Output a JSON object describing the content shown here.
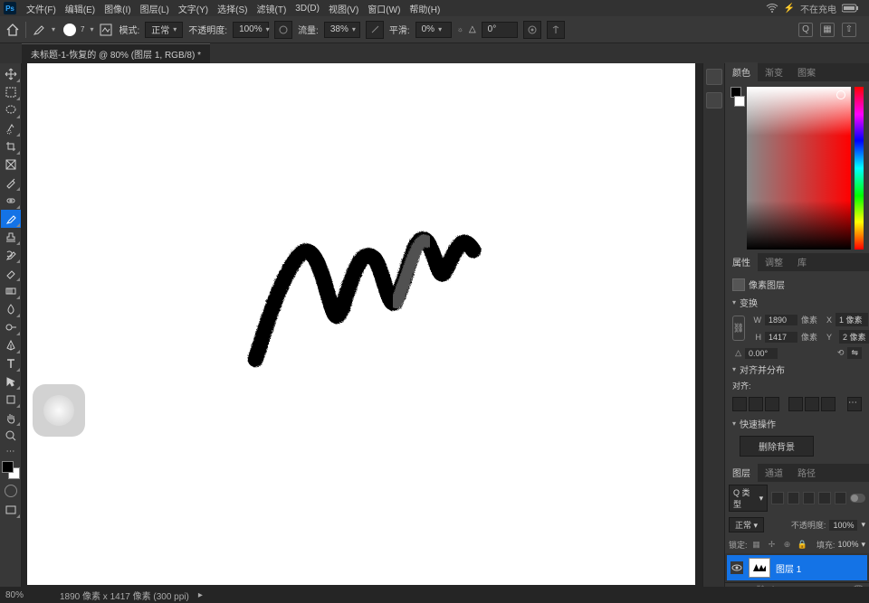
{
  "menubar": {
    "items": [
      "文件(F)",
      "编辑(E)",
      "图像(I)",
      "图层(L)",
      "文字(Y)",
      "选择(S)",
      "滤镜(T)",
      "3D(D)",
      "视图(V)",
      "窗口(W)",
      "帮助(H)"
    ],
    "battery_status": "不在充电"
  },
  "optbar": {
    "brush_size": "7",
    "mode_label": "模式:",
    "mode_value": "正常",
    "opacity_label": "不透明度:",
    "opacity_value": "100%",
    "flow_label": "流量:",
    "flow_value": "38%",
    "smooth_label": "平滑:",
    "smooth_value": "0%",
    "angle_icon": "△",
    "angle_value": "0°"
  },
  "doctab": {
    "title": "未标题-1-恢复的 @ 80% (图层 1, RGB/8) *"
  },
  "properties": {
    "tab_props": "属性",
    "tab_adjust": "调整",
    "tab_lib": "库",
    "header": "像素图层",
    "section_transform": "变换",
    "w_label": "W",
    "w_value": "1890",
    "unit": "像素",
    "x_label": "X",
    "x_value": "1 像素",
    "h_label": "H",
    "h_value": "1417",
    "y_label": "Y",
    "y_value": "2 像素",
    "angle_label": "△",
    "angle_value": "0.00°",
    "flip_label": "⟲",
    "section_align": "对齐并分布",
    "align_label": "对齐:",
    "section_quick": "快速操作",
    "quick_btn": "删除背景"
  },
  "color": {
    "tab_color": "颜色",
    "tab_swatch": "渐变",
    "tab_pattern": "图案"
  },
  "layers": {
    "tab_layers": "图层",
    "tab_channels": "通道",
    "tab_paths": "路径",
    "filter_kind_label": "Q 类型",
    "blend_mode": "正常",
    "opacity_label": "不透明度:",
    "opacity_value": "100%",
    "lock_label": "锁定:",
    "fill_label": "填充:",
    "fill_value": "100%",
    "layer_name": "图层 1"
  },
  "statusbar": {
    "zoom": "80%",
    "doc_info": "1890 像素 x 1417 像素 (300 ppi)"
  }
}
